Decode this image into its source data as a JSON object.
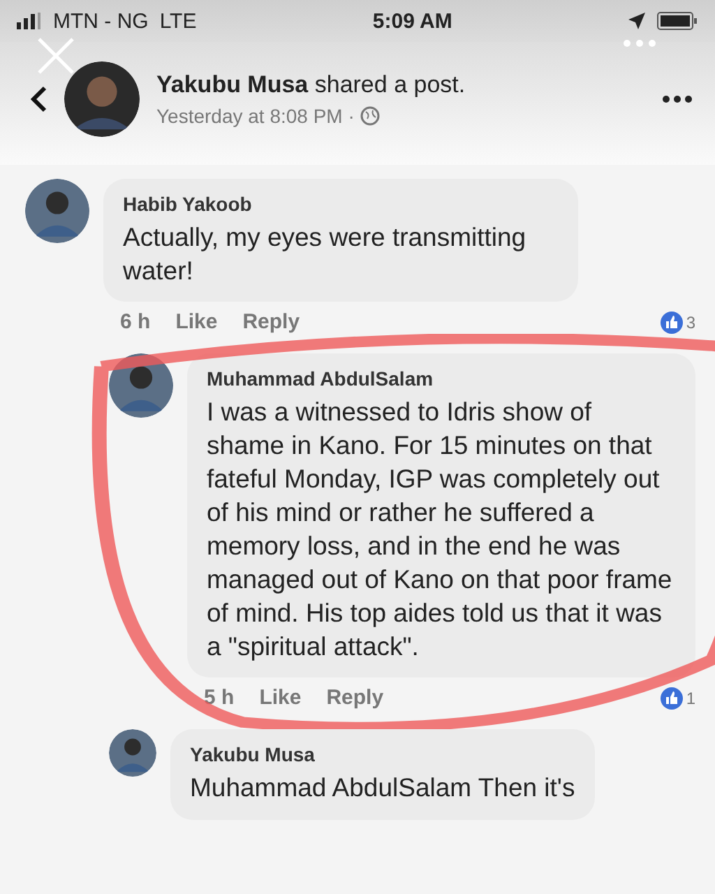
{
  "status_bar": {
    "carrier": "MTN - NG",
    "network": "LTE",
    "time": "5:09 AM"
  },
  "post_header": {
    "title": "**Yakubu Musa** shared a post.",
    "subtitle": "Yesterday at 8:08 PM ·"
  },
  "comments": [
    {
      "author": "Habib Yakoob",
      "text": "Actually, my eyes were transmitting water!",
      "time": "6 h",
      "like": "Like",
      "reply": "Reply",
      "reactions": "3",
      "circled": false,
      "replies": [
        {
          "author": "Muhammad AbdulSalam",
          "text": "I was a witnessed to Idris show of shame in Kano. For 15 minutes on that fateful Monday,  IGP was completely out of his mind or rather he suffered a memory loss, and in the end he was managed out of Kano on that poor frame of mind.  His top aides told us that it was a \"spiritual attack\".",
          "time": "5 h",
          "like": "Like",
          "reply": "Reply",
          "reactions": "1",
          "circled": true
        },
        {
          "author": "Yakubu Musa",
          "text": "Muhammad AbdulSalam Then it's",
          "circled": false
        }
      ]
    }
  ]
}
